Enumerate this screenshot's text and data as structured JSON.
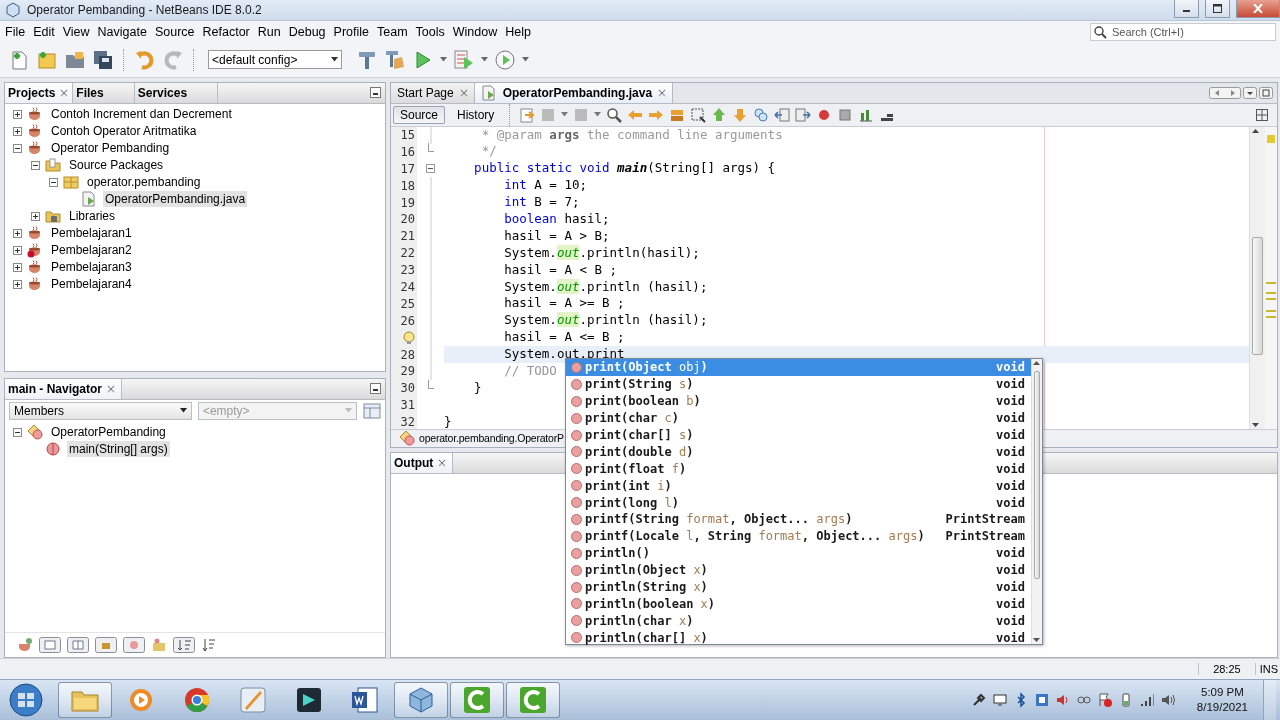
{
  "window": {
    "title": "Operator Pembanding - NetBeans IDE 8.0.2"
  },
  "menu": [
    "File",
    "Edit",
    "View",
    "Navigate",
    "Source",
    "Refactor",
    "Run",
    "Debug",
    "Profile",
    "Team",
    "Tools",
    "Window",
    "Help"
  ],
  "toolbar": {
    "buttons": [
      {
        "kind": "new-file",
        "disabled": false
      },
      {
        "kind": "new-project",
        "disabled": false
      },
      {
        "kind": "open-project",
        "disabled": false
      },
      {
        "kind": "save-all",
        "disabled": false
      },
      {
        "kind": "undo",
        "disabled": false
      },
      {
        "kind": "redo",
        "disabled": true
      }
    ],
    "config": "<default config>",
    "actions": [
      {
        "kind": "build",
        "disabled": false
      },
      {
        "kind": "clean-build",
        "disabled": false
      },
      {
        "kind": "run",
        "disabled": false
      },
      {
        "kind": "debug",
        "disabled": false
      },
      {
        "kind": "profile",
        "disabled": false
      }
    ]
  },
  "search": {
    "placeholder": "Search (Ctrl+I)"
  },
  "projects_panel": {
    "tabs": [
      {
        "label": "Projects",
        "selected": true
      },
      {
        "label": "Files",
        "selected": false
      },
      {
        "label": "Services",
        "selected": false
      }
    ],
    "tree": [
      {
        "label": "Contoh Increment dan Decrement",
        "kind": "project",
        "expanded": false,
        "selected": false
      },
      {
        "label": "Contoh Operator Aritmatika",
        "kind": "project",
        "expanded": false,
        "selected": false
      },
      {
        "label": "Operator Pembanding",
        "kind": "project",
        "expanded": true,
        "selected": false,
        "children": [
          {
            "label": "Source Packages",
            "kind": "source-folder",
            "expanded": true,
            "selected": false,
            "children": [
              {
                "label": "operator.pembanding",
                "kind": "package",
                "expanded": true,
                "selected": false,
                "children": [
                  {
                    "label": "OperatorPembanding.java",
                    "kind": "java-file",
                    "selected": true
                  }
                ]
              }
            ]
          },
          {
            "label": "Libraries",
            "kind": "libraries",
            "expanded": false,
            "selected": false
          }
        ]
      },
      {
        "label": "Pembelajaran1",
        "kind": "project",
        "expanded": false,
        "selected": false
      },
      {
        "label": "Pembelajaran2",
        "kind": "project-error",
        "expanded": false,
        "selected": false
      },
      {
        "label": "Pembelajaran3",
        "kind": "project",
        "expanded": false,
        "selected": false
      },
      {
        "label": "Pembelajaran4",
        "kind": "project",
        "expanded": false,
        "selected": false
      }
    ]
  },
  "navigator": {
    "title": "main - Navigator",
    "filter": "Members",
    "secondary_filter": {
      "value": "<empty>",
      "disabled": true
    },
    "tree": [
      {
        "label": "OperatorPembanding",
        "kind": "class",
        "expanded": true,
        "selected": false,
        "children": [
          {
            "label": "main(String[] args)",
            "kind": "method",
            "selected": true
          }
        ]
      }
    ]
  },
  "editor": {
    "tabs": [
      {
        "label": "Start Page",
        "selected": false
      },
      {
        "label": "OperatorPembanding.java",
        "selected": true
      }
    ],
    "views": [
      {
        "label": "Source",
        "selected": true
      },
      {
        "label": "History",
        "selected": false
      }
    ],
    "lines": [
      {
        "number": "15",
        "kind": "fold-inside",
        "hint": false,
        "current": false,
        "tokens": [
          {
            "kind": "doc",
            "text": "     * @param "
          },
          {
            "kind": "doc-name",
            "text": "args"
          },
          {
            "kind": "doc",
            "text": " the command line arguments"
          }
        ]
      },
      {
        "number": "16",
        "kind": "fold-end",
        "hint": false,
        "current": false,
        "tokens": [
          {
            "kind": "doc",
            "text": "     */"
          }
        ]
      },
      {
        "number": "17",
        "kind": "fold-start",
        "hint": false,
        "current": false,
        "tokens": [
          {
            "kind": "keyword",
            "text": "    public static void "
          },
          {
            "kind": "method",
            "text": "main"
          },
          {
            "kind": "text",
            "text": "(String[] args) {"
          }
        ]
      },
      {
        "number": "18",
        "kind": "fold-inside",
        "hint": false,
        "current": false,
        "tokens": [
          {
            "kind": "keyword",
            "text": "        int"
          },
          {
            "kind": "text",
            "text": " A = 10;"
          }
        ]
      },
      {
        "number": "19",
        "kind": "fold-inside",
        "hint": false,
        "current": false,
        "tokens": [
          {
            "kind": "keyword",
            "text": "        int"
          },
          {
            "kind": "text",
            "text": " B = 7;"
          }
        ]
      },
      {
        "number": "20",
        "kind": "fold-inside",
        "hint": false,
        "current": false,
        "tokens": [
          {
            "kind": "keyword",
            "text": "        boolean"
          },
          {
            "kind": "text",
            "text": " hasil;"
          }
        ]
      },
      {
        "number": "21",
        "kind": "fold-inside",
        "hint": false,
        "current": false,
        "tokens": [
          {
            "kind": "text",
            "text": "        hasil = A > B;"
          }
        ]
      },
      {
        "number": "22",
        "kind": "fold-inside",
        "hint": false,
        "current": false,
        "tokens": [
          {
            "kind": "text",
            "text": "        System."
          },
          {
            "kind": "field",
            "text": "out"
          },
          {
            "kind": "text",
            "text": ".println(hasil);"
          }
        ]
      },
      {
        "number": "23",
        "kind": "fold-inside",
        "hint": false,
        "current": false,
        "tokens": [
          {
            "kind": "text",
            "text": "        hasil = A < B ;"
          }
        ]
      },
      {
        "number": "24",
        "kind": "fold-inside",
        "hint": false,
        "current": false,
        "tokens": [
          {
            "kind": "text",
            "text": "        System."
          },
          {
            "kind": "field",
            "text": "out"
          },
          {
            "kind": "text",
            "text": ".println (hasil);"
          }
        ]
      },
      {
        "number": "25",
        "kind": "fold-inside",
        "hint": false,
        "current": false,
        "tokens": [
          {
            "kind": "text",
            "text": "        hasil = A >= B ;"
          }
        ]
      },
      {
        "number": "26",
        "kind": "fold-inside",
        "hint": false,
        "current": false,
        "tokens": [
          {
            "kind": "text",
            "text": "        System."
          },
          {
            "kind": "field",
            "text": "out"
          },
          {
            "kind": "text",
            "text": ".println (hasil);"
          }
        ]
      },
      {
        "kind": "fold-inside",
        "hint": true,
        "current": false,
        "tokens": [
          {
            "kind": "text",
            "text": "        hasil = A <= B ;"
          }
        ]
      },
      {
        "number": "28",
        "kind": "fold-inside",
        "hint": false,
        "current": true,
        "tokens": [
          {
            "kind": "text",
            "text": "        System.out.print"
          }
        ]
      },
      {
        "number": "29",
        "kind": "fold-inside",
        "hint": false,
        "current": false,
        "tokens": [
          {
            "kind": "comment",
            "text": "        // TODO"
          }
        ]
      },
      {
        "number": "30",
        "kind": "fold-end",
        "hint": false,
        "current": false,
        "tokens": [
          {
            "kind": "text",
            "text": "    }"
          }
        ]
      },
      {
        "number": "31",
        "kind": "plain",
        "hint": false,
        "current": false
      },
      {
        "number": "32",
        "kind": "plain",
        "hint": false,
        "current": false,
        "tokens": [
          {
            "kind": "text",
            "text": "}"
          }
        ]
      }
    ],
    "breadcrumb": "operator.pembanding.OperatorP"
  },
  "output": {
    "title": "Output"
  },
  "completion": {
    "items": [
      {
        "parts": [
          {
            "kind": "name",
            "text": "print(Object "
          },
          {
            "kind": "param",
            "text": "obj"
          },
          {
            "kind": "name",
            "text": ")"
          }
        ],
        "type": "void",
        "selected": true
      },
      {
        "parts": [
          {
            "kind": "name",
            "text": "print(String "
          },
          {
            "kind": "param",
            "text": "s"
          },
          {
            "kind": "name",
            "text": ")"
          }
        ],
        "type": "void",
        "selected": false
      },
      {
        "parts": [
          {
            "kind": "name",
            "text": "print(boolean "
          },
          {
            "kind": "param",
            "text": "b"
          },
          {
            "kind": "name",
            "text": ")"
          }
        ],
        "type": "void",
        "selected": false
      },
      {
        "parts": [
          {
            "kind": "name",
            "text": "print(char "
          },
          {
            "kind": "param",
            "text": "c"
          },
          {
            "kind": "name",
            "text": ")"
          }
        ],
        "type": "void",
        "selected": false
      },
      {
        "parts": [
          {
            "kind": "name",
            "text": "print(char[] "
          },
          {
            "kind": "param",
            "text": "s"
          },
          {
            "kind": "name",
            "text": ")"
          }
        ],
        "type": "void",
        "selected": false
      },
      {
        "parts": [
          {
            "kind": "name",
            "text": "print(double "
          },
          {
            "kind": "param",
            "text": "d"
          },
          {
            "kind": "name",
            "text": ")"
          }
        ],
        "type": "void",
        "selected": false
      },
      {
        "parts": [
          {
            "kind": "name",
            "text": "print(float "
          },
          {
            "kind": "param",
            "text": "f"
          },
          {
            "kind": "name",
            "text": ")"
          }
        ],
        "type": "void",
        "selected": false
      },
      {
        "parts": [
          {
            "kind": "name",
            "text": "print(int "
          },
          {
            "kind": "param",
            "text": "i"
          },
          {
            "kind": "name",
            "text": ")"
          }
        ],
        "type": "void",
        "selected": false
      },
      {
        "parts": [
          {
            "kind": "name",
            "text": "print(long "
          },
          {
            "kind": "param",
            "text": "l"
          },
          {
            "kind": "name",
            "text": ")"
          }
        ],
        "type": "void",
        "selected": false
      },
      {
        "parts": [
          {
            "kind": "name",
            "text": "printf(String "
          },
          {
            "kind": "param",
            "text": "format"
          },
          {
            "kind": "name",
            "text": ", Object... "
          },
          {
            "kind": "param",
            "text": "args"
          },
          {
            "kind": "name",
            "text": ")"
          }
        ],
        "type": "PrintStream",
        "selected": false
      },
      {
        "parts": [
          {
            "kind": "name",
            "text": "printf(Locale "
          },
          {
            "kind": "param",
            "text": "l"
          },
          {
            "kind": "name",
            "text": ", String "
          },
          {
            "kind": "param",
            "text": "format"
          },
          {
            "kind": "name",
            "text": ", Object... "
          },
          {
            "kind": "param",
            "text": "args"
          },
          {
            "kind": "name",
            "text": ")"
          }
        ],
        "type": "PrintStream",
        "selected": false
      },
      {
        "parts": [
          {
            "kind": "name",
            "text": "println()"
          }
        ],
        "type": "void",
        "selected": false
      },
      {
        "parts": [
          {
            "kind": "name",
            "text": "println(Object "
          },
          {
            "kind": "param",
            "text": "x"
          },
          {
            "kind": "name",
            "text": ")"
          }
        ],
        "type": "void",
        "selected": false
      },
      {
        "parts": [
          {
            "kind": "name",
            "text": "println(String "
          },
          {
            "kind": "param",
            "text": "x"
          },
          {
            "kind": "name",
            "text": ")"
          }
        ],
        "type": "void",
        "selected": false
      },
      {
        "parts": [
          {
            "kind": "name",
            "text": "println(boolean "
          },
          {
            "kind": "param",
            "text": "x"
          },
          {
            "kind": "name",
            "text": ")"
          }
        ],
        "type": "void",
        "selected": false
      },
      {
        "parts": [
          {
            "kind": "name",
            "text": "println(char "
          },
          {
            "kind": "param",
            "text": "x"
          },
          {
            "kind": "name",
            "text": ")"
          }
        ],
        "type": "void",
        "selected": false
      },
      {
        "parts": [
          {
            "kind": "name",
            "text": "println(char[] "
          },
          {
            "kind": "param",
            "text": "x"
          },
          {
            "kind": "name",
            "text": ")"
          }
        ],
        "type": "void",
        "selected": false
      }
    ]
  },
  "status_bar": {
    "position": "28:25",
    "mode": "INS"
  },
  "taskbar": {
    "apps": [
      {
        "kind": "folder",
        "running": true
      },
      {
        "kind": "media",
        "running": false
      },
      {
        "kind": "browser",
        "running": false
      },
      {
        "kind": "pen",
        "running": false
      },
      {
        "kind": "video",
        "running": false
      },
      {
        "kind": "document",
        "running": false
      },
      {
        "kind": "cube",
        "running": true
      },
      {
        "kind": "recorder",
        "running": true
      },
      {
        "kind": "recorder",
        "running": true
      }
    ],
    "clock": {
      "time": "5:09 PM",
      "date": "8/19/2021"
    }
  }
}
